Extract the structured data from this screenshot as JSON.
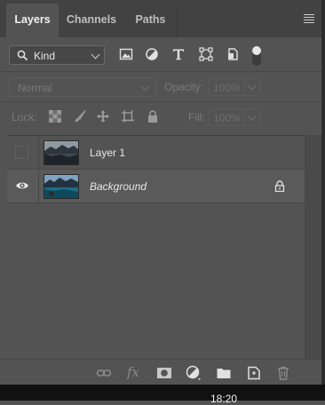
{
  "tabs": [
    {
      "label": "Layers",
      "active": true
    },
    {
      "label": "Channels",
      "active": false
    },
    {
      "label": "Paths",
      "active": false
    }
  ],
  "filter": {
    "kind_label": "Kind",
    "icons": [
      "image-filter-icon",
      "adjustment-filter-icon",
      "type-filter-icon",
      "shape-filter-icon",
      "smart-object-filter-icon"
    ]
  },
  "blend": {
    "mode": "Normal",
    "opacity_label": "Opacity:",
    "opacity_value": "100%"
  },
  "lock": {
    "label": "Lock:",
    "fill_label": "Fill:",
    "fill_value": "100%"
  },
  "layers": [
    {
      "name": "Layer 1",
      "visible": false,
      "locked": false,
      "italic": false
    },
    {
      "name": "Background",
      "visible": true,
      "locked": true,
      "italic": true
    }
  ],
  "bottom": {
    "fx_label": "fx"
  },
  "taskbar": {
    "clock": "18:20"
  },
  "colors": {
    "panel": "#535353",
    "tabbar": "#424242",
    "text": "#d6d6d6"
  }
}
